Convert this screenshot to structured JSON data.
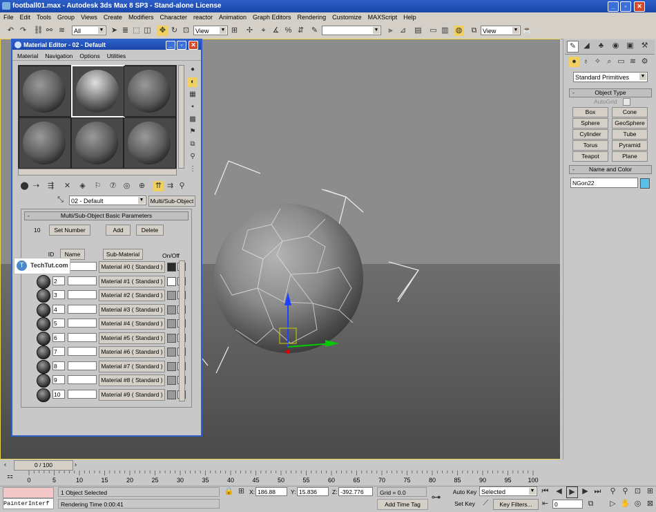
{
  "window": {
    "title": "football01.max - Autodesk 3ds Max 8 SP3 - Stand-alone License"
  },
  "menu": [
    "File",
    "Edit",
    "Tools",
    "Group",
    "Views",
    "Create",
    "Modifiers",
    "Character",
    "reactor",
    "Animation",
    "Graph Editors",
    "Rendering",
    "Customize",
    "MAXScript",
    "Help"
  ],
  "toolbar": {
    "selection_filter": "All",
    "ref_coord": "View",
    "view_combo2": "View",
    "named_sel": ""
  },
  "material_editor": {
    "title": "Material Editor - 02 - Default",
    "menu": [
      "Material",
      "Navigation",
      "Options",
      "Utilities"
    ],
    "material_name": "02 - Default",
    "material_type": "Multi/Sub-Object",
    "rollout_title": "Multi/Sub-Object Basic Parameters",
    "num_materials": "10",
    "set_number": "Set Number",
    "add": "Add",
    "delete": "Delete",
    "col_id": "ID",
    "col_name": "Name",
    "col_sub": "Sub-Material",
    "col_onoff": "On/Off",
    "rows": [
      {
        "id": "1",
        "mat": "Material #0  ( Standard )",
        "color": "#2a2a2a"
      },
      {
        "id": "2",
        "mat": "Material #1  ( Standard )",
        "color": "#ffffff"
      },
      {
        "id": "3",
        "mat": "Material #2  ( Standard )",
        "color": "#9a9a9a"
      },
      {
        "id": "4",
        "mat": "Material #3  ( Standard )",
        "color": "#9a9a9a"
      },
      {
        "id": "5",
        "mat": "Material #4  ( Standard )",
        "color": "#9a9a9a"
      },
      {
        "id": "6",
        "mat": "Material #5  ( Standard )",
        "color": "#9a9a9a"
      },
      {
        "id": "7",
        "mat": "Material #6  ( Standard )",
        "color": "#9a9a9a"
      },
      {
        "id": "8",
        "mat": "Material #7  ( Standard )",
        "color": "#9a9a9a"
      },
      {
        "id": "9",
        "mat": "Material #8  ( Standard )",
        "color": "#9a9a9a"
      },
      {
        "id": "10",
        "mat": "Material #9  ( Standard )",
        "color": "#9a9a9a"
      }
    ],
    "check_mark": "✓"
  },
  "watermark": "TechTut.com",
  "cmd_panel": {
    "category": "Standard Primitives",
    "object_type": "Object Type",
    "autogrid": "AutoGrid",
    "buttons": [
      "Box",
      "Cone",
      "Sphere",
      "GeoSphere",
      "Cylinder",
      "Tube",
      "Torus",
      "Pyramid",
      "Teapot",
      "Plane"
    ],
    "name_color": "Name and Color",
    "object_name": "NGon22",
    "object_color": "#5bc0e8"
  },
  "timeline": {
    "frame": "0 / 100",
    "ticks": [
      "0",
      "5",
      "10",
      "15",
      "20",
      "25",
      "30",
      "35",
      "40",
      "45",
      "50",
      "55",
      "60",
      "65",
      "70",
      "75",
      "80",
      "85",
      "90",
      "95",
      "100"
    ]
  },
  "status": {
    "maxscript": "PainterInterf",
    "selected": "1 Object Selected",
    "render_time": "Rendering Time  0:00:41",
    "x_label": "X:",
    "x": "186.88",
    "y_label": "Y:",
    "y": "15.836",
    "z_label": "Z:",
    "z": "-392.776",
    "grid": "Grid = 0.0",
    "add_time_tag": "Add Time Tag",
    "auto_key": "Auto Key",
    "set_key": "Set Key",
    "key_mode": "Selected",
    "key_filters": "Key Filters...",
    "frame": "0"
  }
}
